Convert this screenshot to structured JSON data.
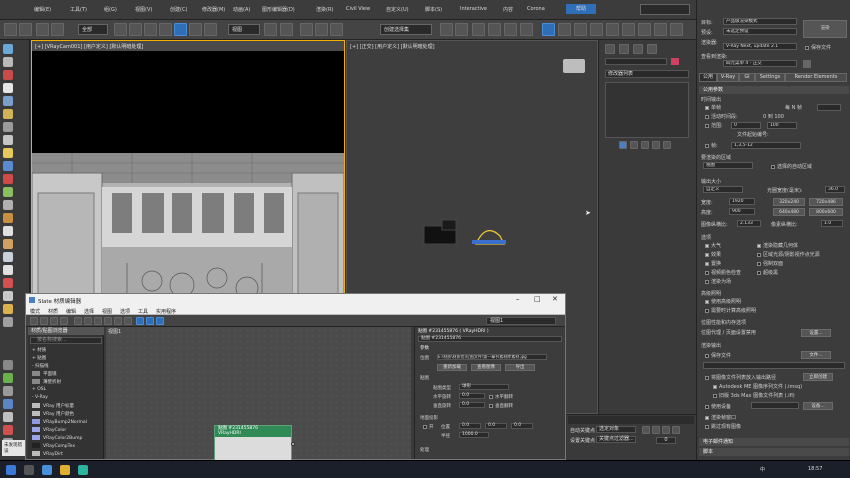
{
  "menu": {
    "items": [
      "编辑(E)",
      "工具(T)",
      "组(G)",
      "视图(V)",
      "创建(C)",
      "修改器(M)",
      "动画(A)",
      "图形编辑器(D)",
      "渲染(R)",
      "Civil View",
      "自定义(U)",
      "脚本(S)",
      "Interactive",
      "内容",
      "Corona",
      "帮助"
    ]
  },
  "toolbar": {
    "selection_filter": "全部",
    "view_dropdown": "视图",
    "named_selection": "创建选择集"
  },
  "viewport_left": {
    "label": "[+] [VRayCam001] [用户定义] [默认明暗处理]"
  },
  "viewport_right": {
    "label": "[+] [正交] [用户定义] [默认明暗处理]"
  },
  "command_panel": {
    "dropdown": "修改器列表"
  },
  "render_setup": {
    "target_label": "目标:",
    "target_value": "产品级渲染模式",
    "preset_label": "预设:",
    "preset_value": "未选定预设",
    "render_button": "渲染",
    "renderer_label": "渲染器:",
    "renderer_value": "V-Ray Next, update 2.1",
    "save_file_label": "保存文件",
    "view_label": "查看到渲染:",
    "view_value": "四元菜单 4 - 正交",
    "tabs": [
      "公用",
      "V-Ray",
      "GI",
      "Settings",
      "Render Elements"
    ],
    "common_params": "公用参数",
    "time_output": "时间输出",
    "single": "单帧",
    "every_n": "每 N 帧",
    "active_segment": "活动时间段:",
    "active_range": "0 到 100",
    "range": "范围:",
    "range_from": "0",
    "range_to": "100",
    "file_start": "文件起始编号:",
    "frames": "帧:",
    "frames_value": "1,3,5-12",
    "area_render": "要渲染的区域",
    "area_value": "视图",
    "auto_region": "选择的自动区域",
    "output_size": "输出大小",
    "custom": "自定义",
    "aperture": "光圈宽度(毫米):",
    "aperture_value": "36.0",
    "width_label": "宽度:",
    "width_value": "1920",
    "height_label": "高度:",
    "height_value": "900",
    "size_presets": [
      "320x240",
      "720x486",
      "640x480",
      "800x600"
    ],
    "aspect_label": "图像纵横比:",
    "aspect_value": "2.133",
    "pixel_aspect": "像素纵横比:",
    "pixel_aspect_value": "1.0",
    "options": "选项",
    "opt_items": [
      "大气",
      "渲染隐藏几何体",
      "效果",
      "区域光源/阴影视作点光源",
      "置换",
      "强制双面",
      "视频颜色检查",
      "超级黑",
      "渲染为场"
    ],
    "advanced_lighting": "高级照明",
    "use_advanced": "使用高级照明",
    "compute_advanced": "需要时计算高级照明",
    "bitmap_perf": "位图性能和内存选项",
    "bitmap_proxy": "位图代理 / 页面设置禁用",
    "setup_button": "设置...",
    "render_output": "渲染输出",
    "save_file": "保存文件",
    "files_button": "文件...",
    "put_image": "将图像文件列表放入输出路径",
    "create_now": "立即创建",
    "autodesk_ime": "Autodesk ME 图像序列文件 (.imsq)",
    "legacy_ifl": "旧版 3ds Max 图像文件列表 (.ifl)",
    "use_device": "使用设备",
    "devices_button": "设备...",
    "render_frame_window": "渲染帧窗口",
    "skip_existing": "跳过现有图像",
    "email": "电子邮件通知",
    "script": "脚本"
  },
  "slate": {
    "title": "Slate 材质编辑器",
    "menu": [
      "模式",
      "材质",
      "编辑",
      "选择",
      "视图",
      "选项",
      "工具",
      "实用程序"
    ],
    "browser_title": "材质/贴图浏览器",
    "search": "按名称搜索...",
    "browser_items": [
      {
        "label": "+ 材质",
        "swatch": ""
      },
      {
        "label": "+ 贴图",
        "swatch": ""
      },
      {
        "label": "- 扫描线",
        "swatch": ""
      },
      {
        "label": "平面镜",
        "swatch": "#888888"
      },
      {
        "label": "薄壁折射",
        "swatch": "#888888"
      },
      {
        "label": "+ OSL",
        "swatch": ""
      },
      {
        "label": "- V-Ray",
        "swatch": ""
      },
      {
        "label": "VRay 用户标量",
        "swatch": "#bdbdbd"
      },
      {
        "label": "VRay 用户颜色",
        "swatch": "#bdbdbd"
      },
      {
        "label": "VRayBump2Normal",
        "swatch": "#8f9be0"
      },
      {
        "label": "VRayColor",
        "swatch": "#9aa6e8"
      },
      {
        "label": "VRayColor2Bump",
        "swatch": "#9aa6e8"
      },
      {
        "label": "VRayCompTex",
        "swatch": "#222222"
      },
      {
        "label": "VRayDirt",
        "swatch": "#bbbbbb"
      }
    ],
    "view_label": "视图1",
    "node_title": "贴图 #231455876",
    "node_sub": "VRayHDRI",
    "params_header": "贴图 #231455876 ( VRayHDRI )",
    "params_sub": "贴图 #231455876",
    "params_section": "参数",
    "location": "位图",
    "location_value": "E:\\材质\\材质包\\位图文件\\第一章节素材库素材.jpg",
    "reload": "重新加载",
    "view_image": "查看图像",
    "import": "导出",
    "mapping_label": "贴图",
    "mapping_type_label": "贴图类型",
    "mapping_type": "球形",
    "h_rot": "水平旋转",
    "h_rot_value": "0.0",
    "h_flip": "水平翻转",
    "v_rot": "垂直旋转",
    "v_rot_value": "0.0",
    "v_flip": "垂直翻转",
    "ground_proj": "地面投影",
    "on": "开",
    "position": "位置",
    "pos_x": "0.0",
    "pos_y": "0.0",
    "pos_z": "0.0",
    "radius": "半径",
    "radius_value": "1000.0",
    "processing": "处理"
  },
  "timeline": {
    "auto_key": "自动关键点",
    "selected": "选定对象",
    "set_key": "设置关键点",
    "key_filter": "关键点过滤器...",
    "frame": "0"
  },
  "status": {
    "prompt": "未发现错误"
  },
  "taskbar": {
    "time": "18:57",
    "lang": "中"
  }
}
